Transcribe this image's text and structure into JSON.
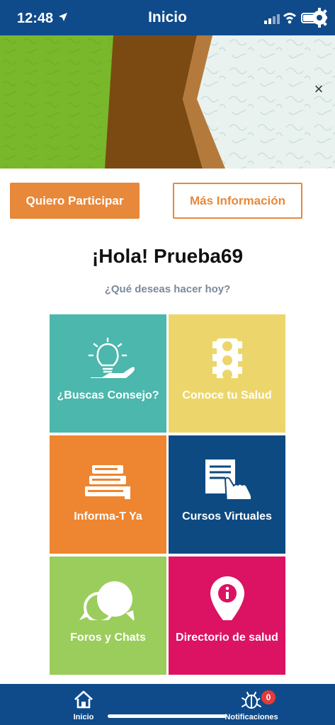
{
  "status_bar": {
    "time": "12:48"
  },
  "header": {
    "title": "Inicio"
  },
  "buttons": {
    "participate": "Quiero Participar",
    "more_info": "Más Información"
  },
  "banner": {
    "close_glyph": "×"
  },
  "greeting": {
    "title": "¡Hola! Prueba69",
    "subtitle": "¿Qué deseas hacer hoy?"
  },
  "tiles": [
    {
      "label": "¿Buscas Consejo?",
      "icon": "lightbulb-hand-icon",
      "color": "#4cb7ac"
    },
    {
      "label": "Conoce tu Salud",
      "icon": "traffic-light-icon",
      "color": "#ecd66c"
    },
    {
      "label": "Informa-T Ya",
      "icon": "books-icon",
      "color": "#ee8530"
    },
    {
      "label": "Cursos Virtuales",
      "icon": "document-pointer-icon",
      "color": "#0d4a82"
    },
    {
      "label": "Foros y Chats",
      "icon": "chat-bubbles-icon",
      "color": "#9acd5c"
    },
    {
      "label": "Directorio de salud",
      "icon": "location-pin-icon",
      "color": "#dc1262"
    }
  ],
  "tab_bar": {
    "items": [
      {
        "label": "Inicio",
        "icon": "home-icon"
      },
      {
        "label": "Notificaciones",
        "icon": "bug-icon",
        "badge": "0"
      }
    ]
  },
  "colors": {
    "primary": "#0f4b8a",
    "accent": "#e8883a"
  }
}
